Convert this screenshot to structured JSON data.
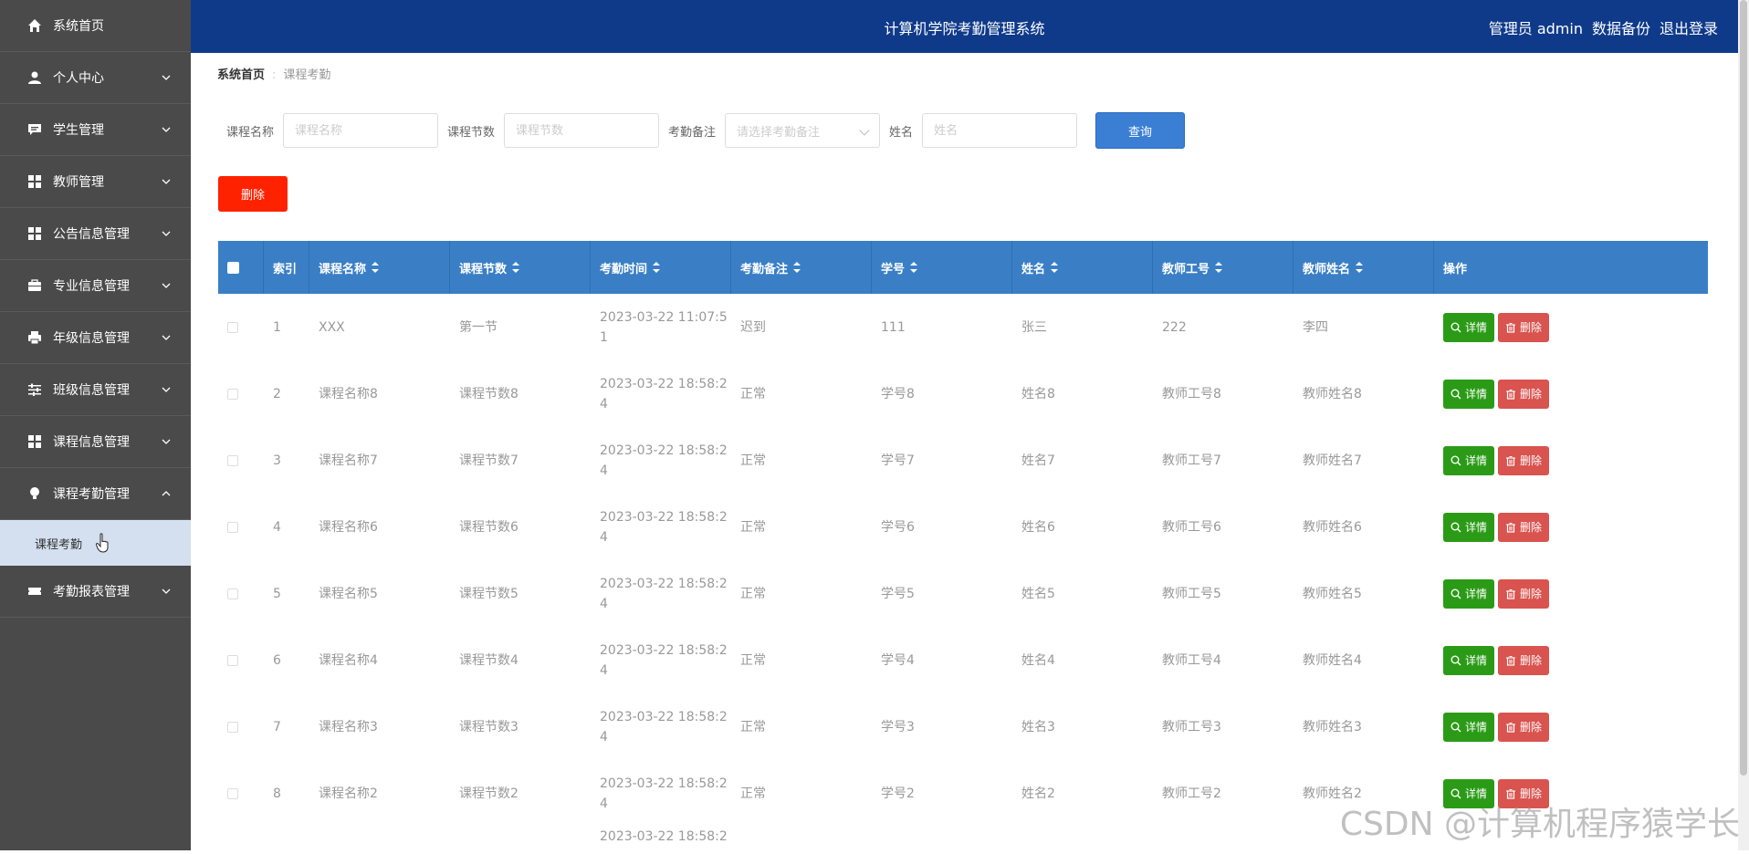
{
  "header": {
    "title": "计算机学院考勤管理系统",
    "user": "管理员 admin",
    "backup": "数据备份",
    "logout": "退出登录",
    "bg_color": "#0f3a8a"
  },
  "sidebar": {
    "items": [
      {
        "label": "系统首页",
        "icon": "home-icon"
      },
      {
        "label": "个人中心",
        "icon": "person-icon"
      },
      {
        "label": "学生管理",
        "icon": "chat-icon"
      },
      {
        "label": "教师管理",
        "icon": "grid-icon"
      },
      {
        "label": "公告信息管理",
        "icon": "grid-icon"
      },
      {
        "label": "专业信息管理",
        "icon": "briefcase-icon"
      },
      {
        "label": "年级信息管理",
        "icon": "printer-icon"
      },
      {
        "label": "班级信息管理",
        "icon": "sliders-icon"
      },
      {
        "label": "课程信息管理",
        "icon": "grid-icon"
      },
      {
        "label": "课程考勤管理",
        "icon": "bulb-icon"
      },
      {
        "label": "考勤报表管理",
        "icon": "ticket-icon"
      }
    ],
    "active_sub": "课程考勤"
  },
  "breadcrumb": {
    "home": "系统首页",
    "current": "课程考勤"
  },
  "search": {
    "course_name_label": "课程名称",
    "course_name_placeholder": "课程名称",
    "section_label": "课程节数",
    "section_placeholder": "课程节数",
    "remark_label": "考勤备注",
    "remark_placeholder": "请选择考勤备注",
    "name_label": "姓名",
    "name_placeholder": "姓名",
    "query": "查询"
  },
  "toolbar": {
    "delete": "删除"
  },
  "table": {
    "headers": [
      "索引",
      "课程名称",
      "课程节数",
      "考勤时间",
      "考勤备注",
      "学号",
      "姓名",
      "教师工号",
      "教师姓名",
      "操作"
    ],
    "detail_label": "详情",
    "delete_label": "删除",
    "rows": [
      {
        "idx": "1",
        "course": "XXX",
        "section": "第一节",
        "time1": "2023-03-22 11:07:5",
        "time2": "1",
        "remark": "迟到",
        "sid": "111",
        "name": "张三",
        "tid": "222",
        "tname": "李四"
      },
      {
        "idx": "2",
        "course": "课程名称8",
        "section": "课程节数8",
        "time1": "2023-03-22 18:58:2",
        "time2": "4",
        "remark": "正常",
        "sid": "学号8",
        "name": "姓名8",
        "tid": "教师工号8",
        "tname": "教师姓名8"
      },
      {
        "idx": "3",
        "course": "课程名称7",
        "section": "课程节数7",
        "time1": "2023-03-22 18:58:2",
        "time2": "4",
        "remark": "正常",
        "sid": "学号7",
        "name": "姓名7",
        "tid": "教师工号7",
        "tname": "教师姓名7"
      },
      {
        "idx": "4",
        "course": "课程名称6",
        "section": "课程节数6",
        "time1": "2023-03-22 18:58:2",
        "time2": "4",
        "remark": "正常",
        "sid": "学号6",
        "name": "姓名6",
        "tid": "教师工号6",
        "tname": "教师姓名6"
      },
      {
        "idx": "5",
        "course": "课程名称5",
        "section": "课程节数5",
        "time1": "2023-03-22 18:58:2",
        "time2": "4",
        "remark": "正常",
        "sid": "学号5",
        "name": "姓名5",
        "tid": "教师工号5",
        "tname": "教师姓名5"
      },
      {
        "idx": "6",
        "course": "课程名称4",
        "section": "课程节数4",
        "time1": "2023-03-22 18:58:2",
        "time2": "4",
        "remark": "正常",
        "sid": "学号4",
        "name": "姓名4",
        "tid": "教师工号4",
        "tname": "教师姓名4"
      },
      {
        "idx": "7",
        "course": "课程名称3",
        "section": "课程节数3",
        "time1": "2023-03-22 18:58:2",
        "time2": "4",
        "remark": "正常",
        "sid": "学号3",
        "name": "姓名3",
        "tid": "教师工号3",
        "tname": "教师姓名3"
      },
      {
        "idx": "8",
        "course": "课程名称2",
        "section": "课程节数2",
        "time1": "2023-03-22 18:58:2",
        "time2": "4",
        "remark": "正常",
        "sid": "学号2",
        "name": "姓名2",
        "tid": "教师工号2",
        "tname": "教师姓名2"
      }
    ],
    "partial_time": "2023-03-22 18:58:2"
  },
  "watermark": "CSDN @计算机程序猿学长"
}
